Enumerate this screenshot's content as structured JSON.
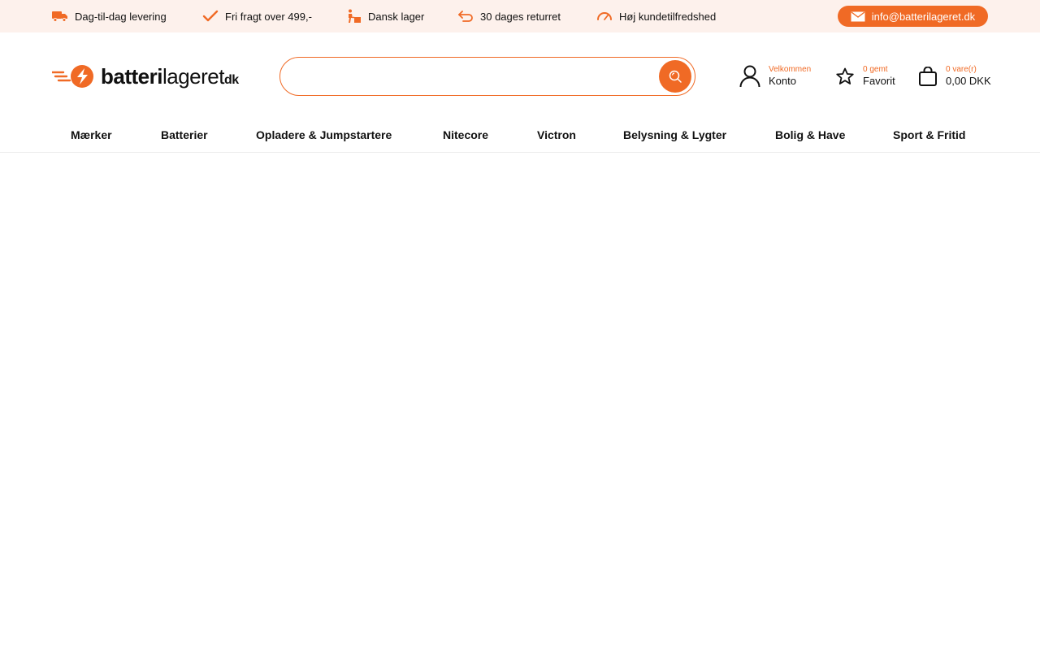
{
  "topbar": {
    "usps": [
      {
        "label": "Dag-til-dag levering",
        "icon": "truck-icon"
      },
      {
        "label": "Fri fragt over 499,-",
        "icon": "checkmark-icon"
      },
      {
        "label": "Dansk lager",
        "icon": "warehouse-worker-icon"
      },
      {
        "label": "30 dages returret",
        "icon": "return-arrow-icon"
      },
      {
        "label": "Høj kundetilfredshed",
        "icon": "gauge-icon"
      }
    ],
    "email": "info@batterilageret.dk"
  },
  "header": {
    "logo": {
      "part1": "batteri",
      "part2": "lageret",
      "part3": "dk"
    },
    "search": {
      "value": "",
      "placeholder": ""
    },
    "account": {
      "small": "Velkommen",
      "label": "Konto"
    },
    "favorites": {
      "small": "0 gemt",
      "label": "Favorit"
    },
    "cart": {
      "small": "0 vare(r)",
      "label": "0,00 DKK"
    }
  },
  "nav": {
    "items": [
      "Mærker",
      "Batterier",
      "Opladere & Jumpstartere",
      "Nitecore",
      "Victron",
      "Belysning & Lygter",
      "Bolig & Have",
      "Sport & Fritid"
    ]
  },
  "colors": {
    "accent": "#f06a25",
    "topbar_bg": "#fdf1ec"
  }
}
